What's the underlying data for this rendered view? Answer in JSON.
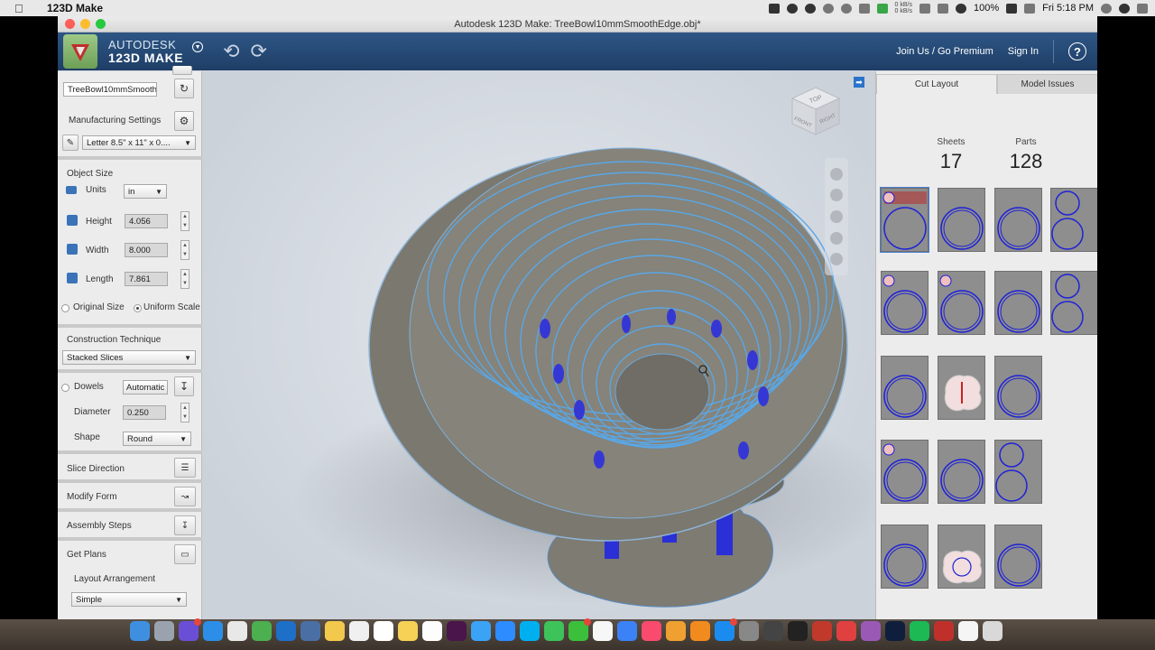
{
  "menubar": {
    "app_name": "123D Make",
    "net_up": "0 kB/s",
    "net_down": "0 kB/s",
    "battery": "100%",
    "clock": "Fri 5:18 PM"
  },
  "window": {
    "title": "Autodesk 123D Make: TreeBowl10mmSmoothEdge.obj*"
  },
  "appbar": {
    "brand_line1": "AUTODESK",
    "brand_line2": "123D",
    "brand_line2b": "MAKE",
    "join_link": "Join Us / Go Premium",
    "signin_link": "Sign In",
    "help": "?"
  },
  "left": {
    "model_name": "TreeBowl10mmSmooth",
    "manufacturing_settings": "Manufacturing Settings",
    "sheet_preset": "Letter 8.5\" x 11\" x 0....",
    "object_size": "Object Size",
    "units_label": "Units",
    "units_value": "in",
    "height_label": "Height",
    "height_value": "4.056",
    "width_label": "Width",
    "width_value": "8.000",
    "length_label": "Length",
    "length_value": "7.861",
    "original_size": "Original Size",
    "uniform_scale": "Uniform Scale",
    "construction_technique": "Construction Technique",
    "technique_value": "Stacked Slices",
    "dowels": "Dowels",
    "dowels_mode": "Automatic",
    "diameter_label": "Diameter",
    "diameter_value": "0.250",
    "shape_label": "Shape",
    "shape_value": "Round",
    "slice_direction": "Slice Direction",
    "modify_form": "Modify Form",
    "assembly_steps": "Assembly Steps",
    "get_plans": "Get Plans",
    "layout_arrangement": "Layout Arrangement",
    "layout_value": "Simple"
  },
  "viewcube": {
    "top": "TOP",
    "front": "FRONT",
    "right": "RIGHT"
  },
  "right": {
    "tab_cut_layout": "Cut Layout",
    "tab_model_issues": "Model Issues",
    "sheets_label": "Sheets",
    "sheets_value": "17",
    "parts_label": "Parts",
    "parts_value": "128"
  },
  "colors": {
    "appbar": "#1e3e66",
    "accent": "#2a74c9",
    "slice_outline": "#1f22d6"
  }
}
